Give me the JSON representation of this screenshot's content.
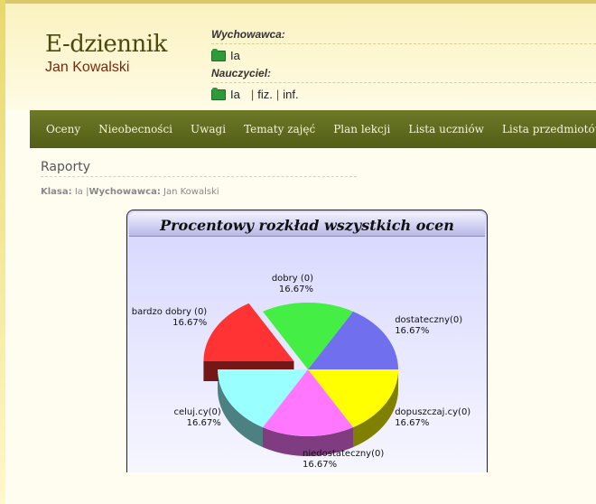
{
  "header": {
    "title": "E-dziennik",
    "subtitle": "Jan Kowalski",
    "wychowawca_label": "Wychowawca:",
    "wychowawca_class": "Ia",
    "nauczyciel_label": "Nauczyciel:",
    "nauczyciel_class": "Ia",
    "subjects": [
      "fiz.",
      "inf."
    ]
  },
  "nav": {
    "items": [
      "Oceny",
      "Nieobecności",
      "Uwagi",
      "Tematy zajęć",
      "Plan lekcji",
      "Lista uczniów",
      "Lista przedmiotów"
    ]
  },
  "page": {
    "title": "Raporty",
    "class_label": "Klasa:",
    "class_value": "Ia",
    "teacher_label": "Wychowawca:",
    "teacher_value": "Jan Kowalski"
  },
  "chart_data": {
    "type": "pie",
    "title": "Procentowy rozkład wszystkich ocen",
    "slices": [
      {
        "name": "dostateczny",
        "count": 0,
        "percent": 16.67,
        "label": "dostateczny(0)",
        "percent_label": "16.67%",
        "color": "#7070ee"
      },
      {
        "name": "dopuszczający",
        "count": 0,
        "percent": 16.67,
        "label": "dopuszczaj.cy(0)",
        "percent_label": "16.67%",
        "color": "#ffff00"
      },
      {
        "name": "niedostateczny",
        "count": 0,
        "percent": 16.67,
        "label": "niedostateczny(0)",
        "percent_label": "16.67%",
        "color": "#ff77ff"
      },
      {
        "name": "celujący",
        "count": 0,
        "percent": 16.67,
        "label": "celuj.cy(0)",
        "percent_label": "16.67%",
        "color": "#99ffff"
      },
      {
        "name": "bardzo dobry",
        "count": 0,
        "percent": 16.67,
        "label": "bardzo dobry (0)",
        "percent_label": "16.67%",
        "color": "#ff3333"
      },
      {
        "name": "dobry",
        "count": 0,
        "percent": 16.67,
        "label": "dobry (0)",
        "percent_label": "16.67%",
        "color": "#44ee44"
      }
    ]
  },
  "colors": {
    "navbar": "#5f6b1f",
    "header_bg": "#fbf2c0",
    "chart_bg": "#e6e6ff"
  }
}
